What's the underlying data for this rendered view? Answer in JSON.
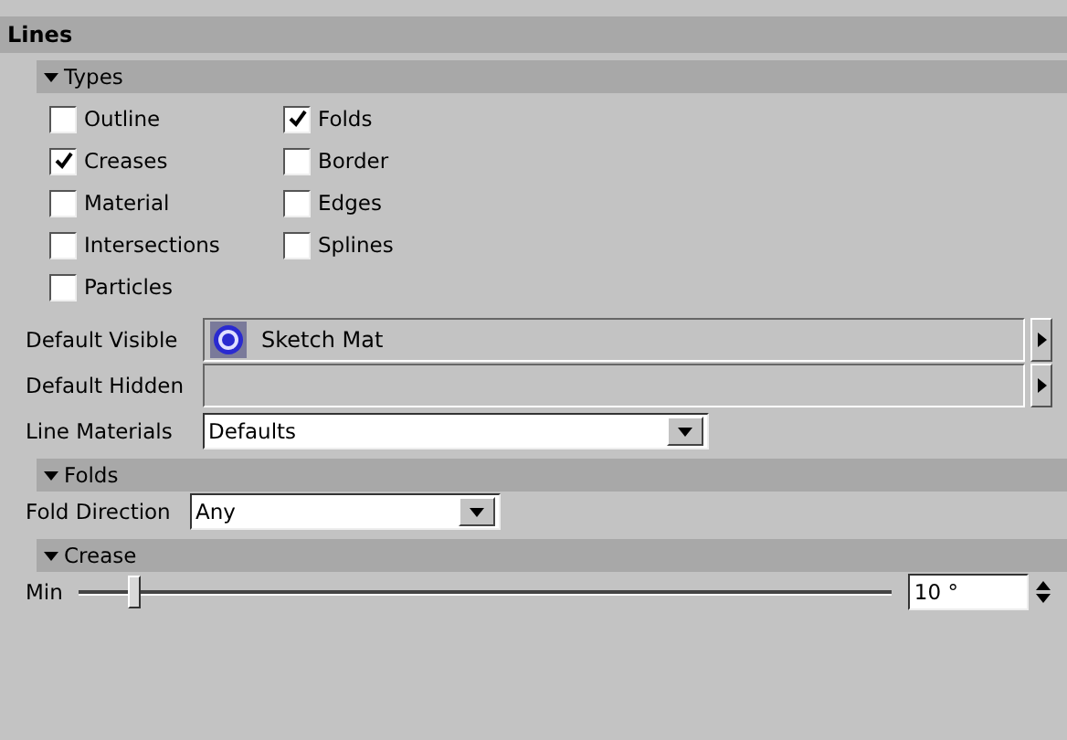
{
  "panel": {
    "title": "Lines"
  },
  "types": {
    "header": "Types",
    "expanded": true,
    "options": [
      {
        "label": "Outline",
        "checked": false
      },
      {
        "label": "Creases",
        "checked": true
      },
      {
        "label": "Material",
        "checked": false
      },
      {
        "label": "Intersections",
        "checked": false
      },
      {
        "label": "Particles",
        "checked": false
      },
      {
        "label": "Folds",
        "checked": true
      },
      {
        "label": "Border",
        "checked": false
      },
      {
        "label": "Edges",
        "checked": false
      },
      {
        "label": "Splines",
        "checked": false
      }
    ]
  },
  "fields": [
    {
      "kind": "link",
      "label": "Default Visible",
      "value": "Sketch Mat"
    },
    {
      "kind": "link",
      "label": "Default Hidden"
    },
    {
      "kind": "dropdown",
      "label": "Line Materials",
      "value": "Defaults"
    }
  ],
  "folds": {
    "header": "Folds",
    "expanded": true,
    "label": "Fold Direction",
    "value": "Any"
  },
  "crease": {
    "header": "Crease",
    "expanded": true,
    "label": "Min",
    "level": 0.06,
    "value": "10 °"
  }
}
